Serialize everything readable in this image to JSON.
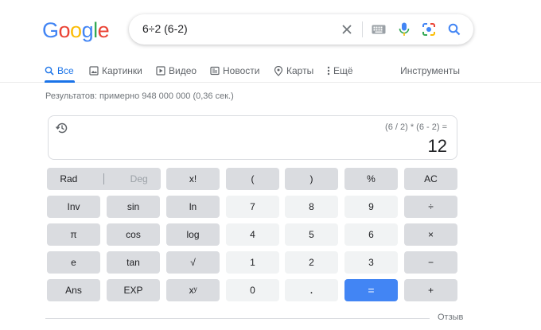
{
  "logo": {
    "letters": [
      "G",
      "o",
      "o",
      "g",
      "l",
      "e"
    ],
    "colors": [
      "#4285f4",
      "#ea4335",
      "#fbbc05",
      "#4285f4",
      "#34a853",
      "#ea4335"
    ]
  },
  "search": {
    "query": "6÷2 (6-2)",
    "icons": [
      "close-icon",
      "keyboard-icon",
      "microphone-icon",
      "lens-camera-icon",
      "search-icon"
    ]
  },
  "tabs": [
    {
      "label": "Все",
      "icon": "search-icon",
      "active": true
    },
    {
      "label": "Картинки",
      "icon": "image-icon",
      "active": false
    },
    {
      "label": "Видео",
      "icon": "video-icon",
      "active": false
    },
    {
      "label": "Новости",
      "icon": "news-icon",
      "active": false
    },
    {
      "label": "Карты",
      "icon": "map-pin-icon",
      "active": false
    },
    {
      "label": "Ещё",
      "icon": "more-vert-icon",
      "active": false
    }
  ],
  "tools_label": "Инструменты",
  "stats": "Результатов: примерно 948 000 000 (0,36 сек.)",
  "calculator": {
    "expression": "(6 / 2) * (6 - 2) =",
    "result": "12",
    "keys": {
      "rad": "Rad",
      "deg": "Deg",
      "fact": "x!",
      "lparen": "(",
      "rparen": ")",
      "percent": "%",
      "ac": "AC",
      "inv": "Inv",
      "sin": "sin",
      "ln": "ln",
      "n7": "7",
      "n8": "8",
      "n9": "9",
      "div": "÷",
      "pi": "π",
      "cos": "cos",
      "log": "log",
      "n4": "4",
      "n5": "5",
      "n6": "6",
      "mul": "×",
      "e": "e",
      "tan": "tan",
      "sqrt": "√",
      "n1": "1",
      "n2": "2",
      "n3": "3",
      "sub": "−",
      "ans": "Ans",
      "exp": "EXP",
      "pow": "xʸ",
      "n0": "0",
      "dot": ".",
      "eq": "=",
      "add": "+"
    }
  },
  "feedback": "Отзыв",
  "colors": {
    "accent": "#1a73e8",
    "equals": "#4285f4"
  }
}
